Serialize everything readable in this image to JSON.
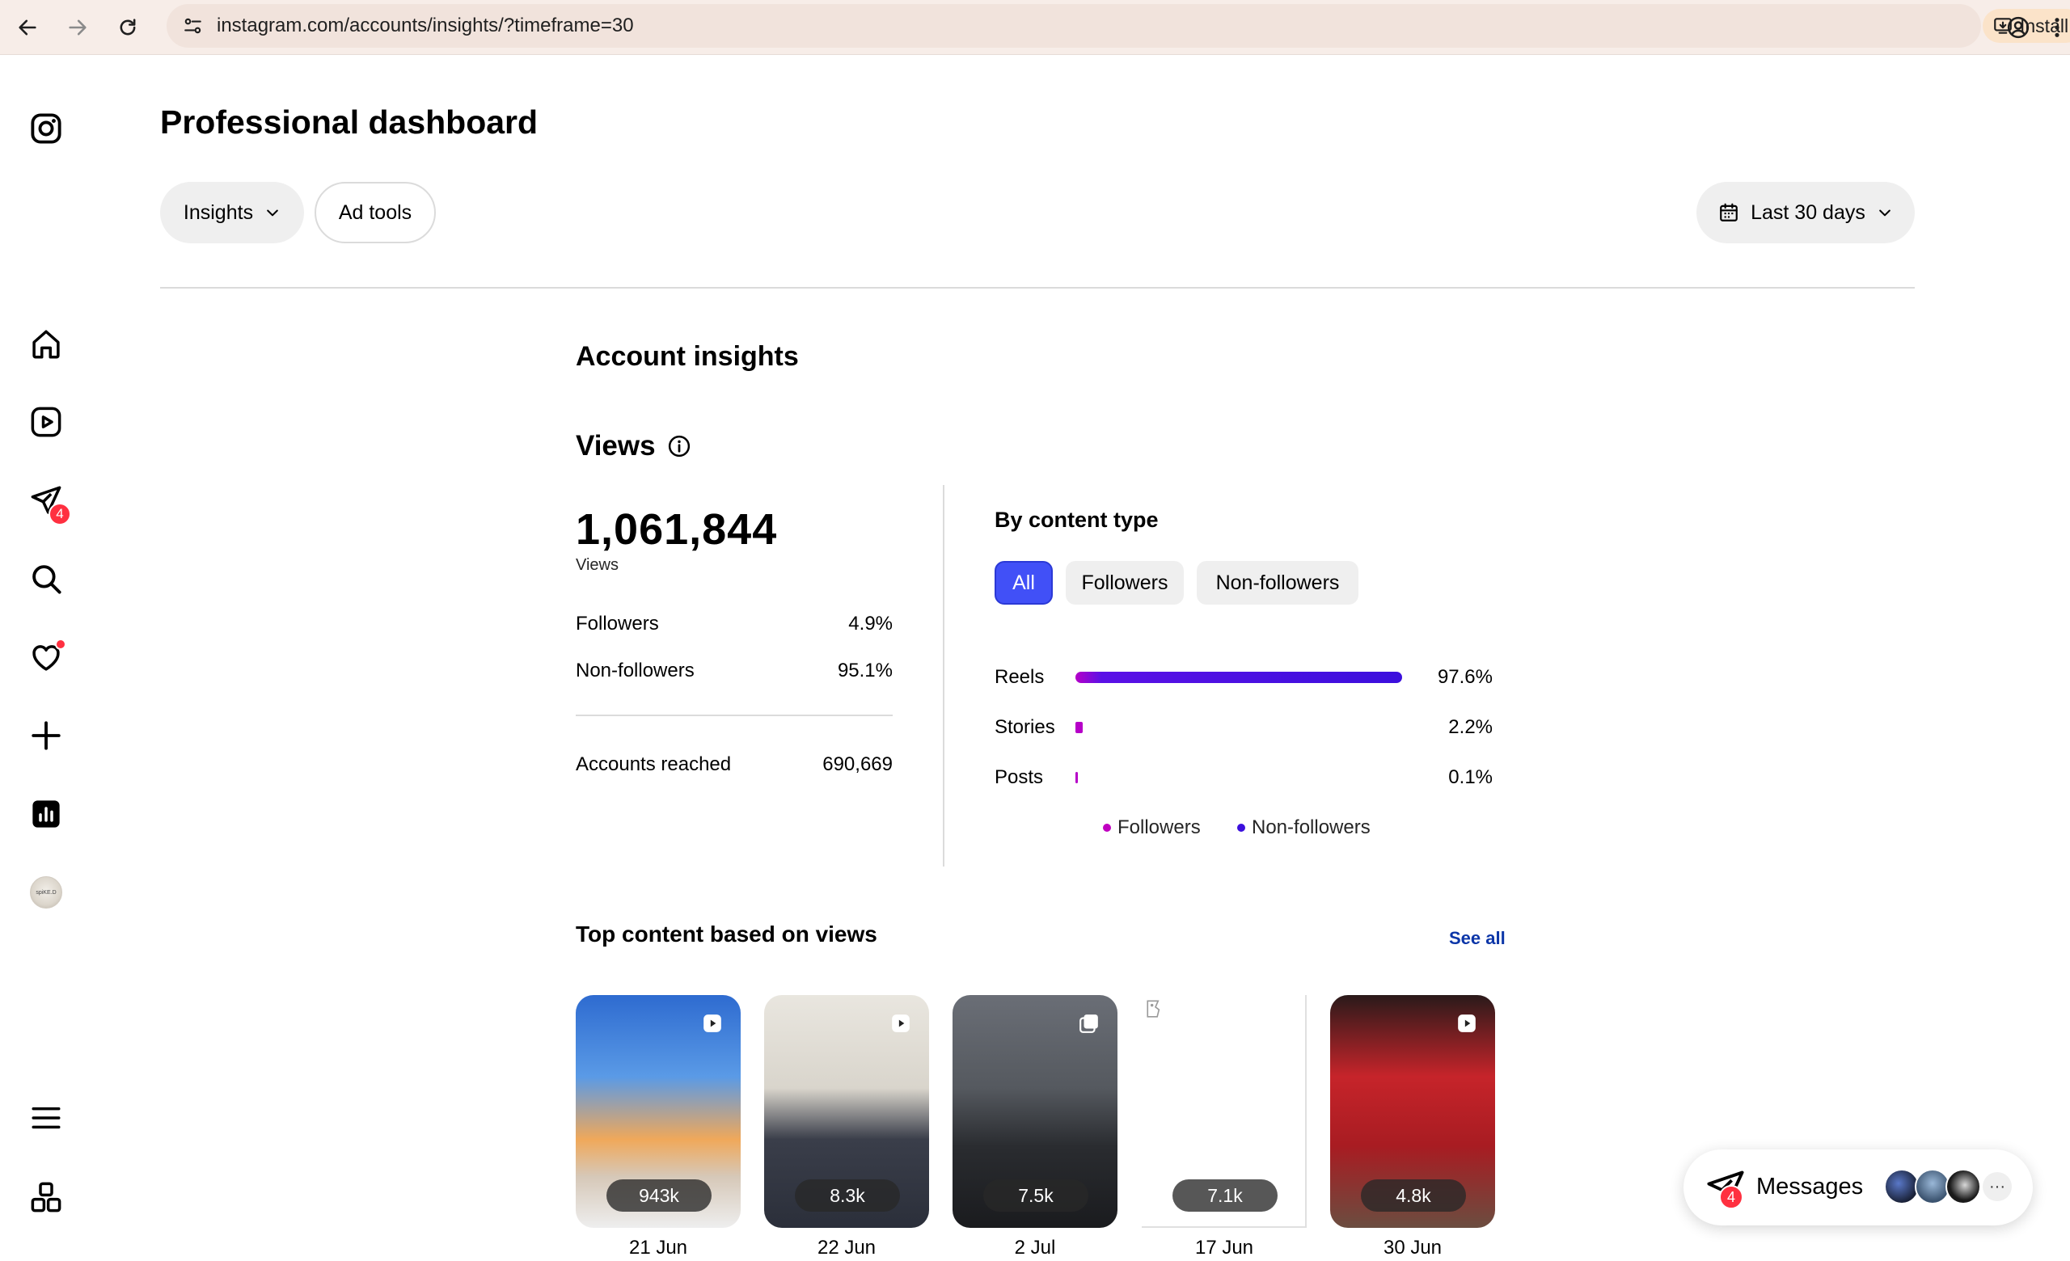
{
  "browser": {
    "url": "instagram.com/accounts/insights/?timeframe=30",
    "install_label": "Install"
  },
  "sidebar": {
    "items": [
      {
        "name": "instagram-logo-icon"
      },
      {
        "name": "home-icon"
      },
      {
        "name": "reels-icon"
      },
      {
        "name": "messages-icon",
        "badge": "4"
      },
      {
        "name": "search-icon"
      },
      {
        "name": "notifications-icon"
      },
      {
        "name": "create-icon"
      },
      {
        "name": "dashboard-icon"
      },
      {
        "name": "profile-avatar",
        "avatar_text": "spiKE.D"
      },
      {
        "name": "menu-icon"
      },
      {
        "name": "more-apps-icon"
      }
    ]
  },
  "header": {
    "title": "Professional dashboard",
    "insights_label": "Insights",
    "adtools_label": "Ad tools",
    "date_range_label": "Last 30 days"
  },
  "insights": {
    "title": "Account insights",
    "views_title": "Views",
    "total_views": "1,061,844",
    "total_label": "Views",
    "stats": [
      {
        "label": "Followers",
        "value": "4.9%"
      },
      {
        "label": "Non-followers",
        "value": "95.1%"
      }
    ],
    "accounts_reached_label": "Accounts reached",
    "accounts_reached_value": "690,669"
  },
  "by_content_type": {
    "title": "By content type",
    "tabs": [
      "All",
      "Followers",
      "Non-followers"
    ],
    "legend": [
      "Followers",
      "Non-followers"
    ]
  },
  "chart_data": {
    "type": "bar",
    "title": "By content type",
    "categories": [
      "Reels",
      "Stories",
      "Posts"
    ],
    "values": [
      97.6,
      2.2,
      0.1
    ],
    "labels": [
      "97.6%",
      "2.2%",
      "0.1%"
    ],
    "xlim": [
      0,
      100
    ],
    "orientation": "horizontal"
  },
  "top_content": {
    "title": "Top content based on views",
    "see_all": "See all",
    "items": [
      {
        "count": "943k",
        "date": "21 Jun",
        "kind": "reel"
      },
      {
        "count": "8.3k",
        "date": "22 Jun",
        "kind": "reel"
      },
      {
        "count": "7.5k",
        "date": "2 Jul",
        "kind": "carousel"
      },
      {
        "count": "7.1k",
        "date": "17 Jun",
        "kind": "broken"
      },
      {
        "count": "4.8k",
        "date": "30 Jun",
        "kind": "reel"
      }
    ]
  },
  "messages": {
    "label": "Messages",
    "badge": "4",
    "more": "···"
  },
  "colors": {
    "accent": "#4150f7",
    "badge": "#ff3040",
    "followers_dot": "#c000c0",
    "nonfollowers_dot": "#3b0fdd",
    "link": "#0c36a8"
  }
}
